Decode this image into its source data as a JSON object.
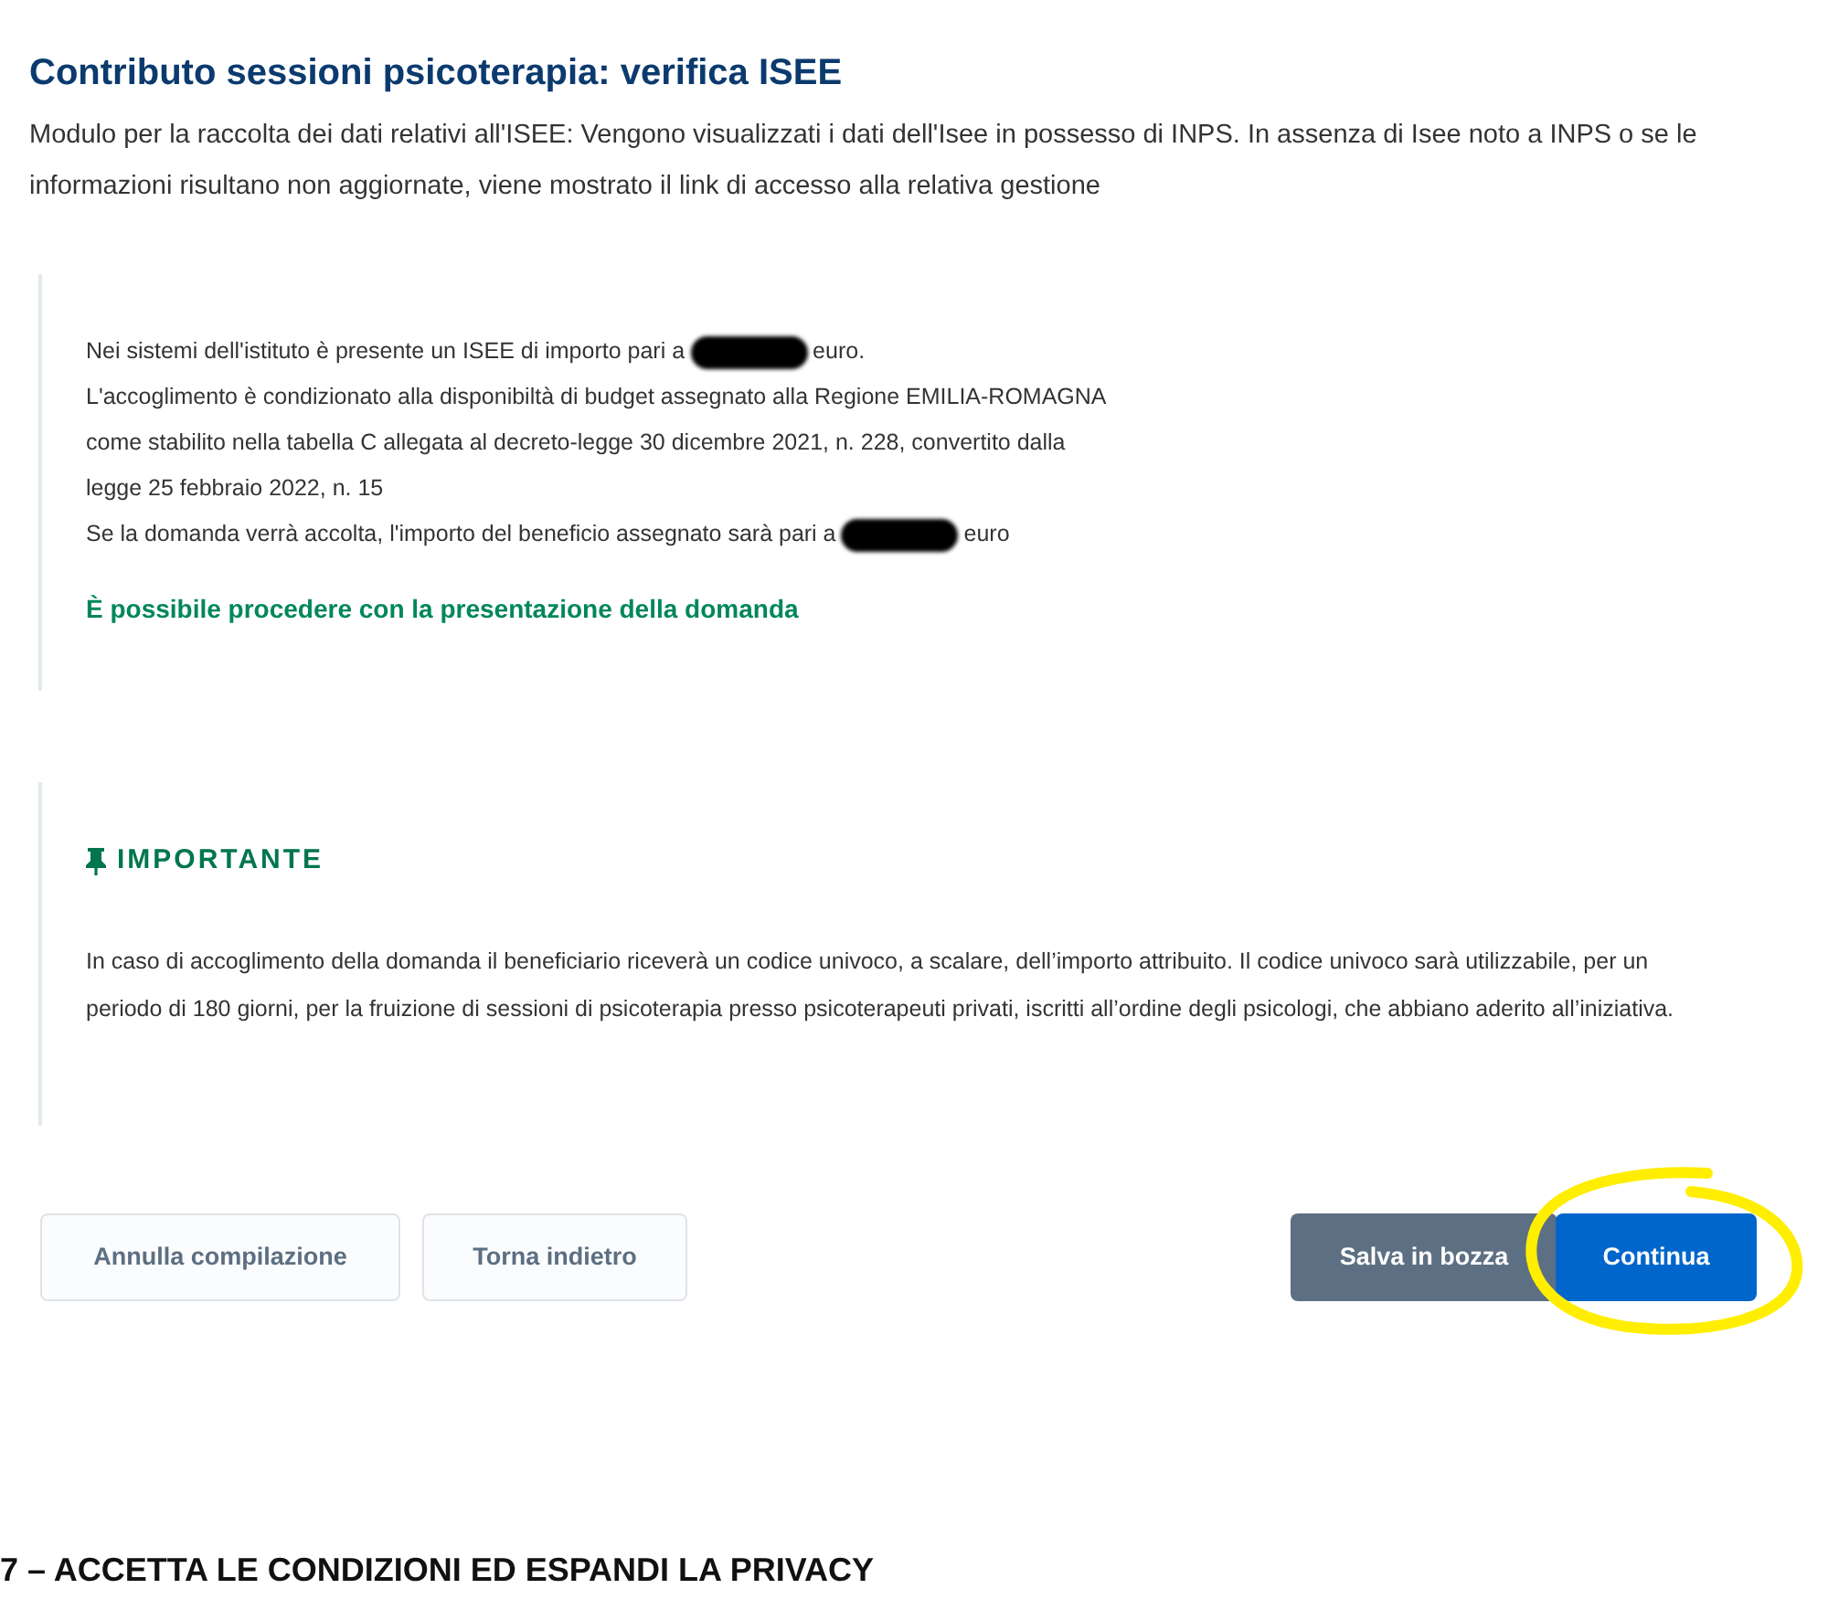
{
  "page": {
    "title": "Contributo sessioni psicoterapia: verifica ISEE",
    "description": "Modulo per la raccolta dei dati relativi all'ISEE: Vengono visualizzati i dati dell'Isee in possesso di INPS. In assenza di Isee noto a INPS o se le informazioni risultano non aggiornate, viene mostrato il link di accesso alla relativa gestione"
  },
  "isee_box": {
    "lines": [
      {
        "kind": "redacted",
        "before": "Nei sistemi dell'istituto è presente un ISEE di importo pari a",
        "after": "euro."
      },
      {
        "kind": "text",
        "text": "L'accoglimento è condizionato alla disponibiltà di budget assegnato alla Regione EMILIA-ROMAGNA"
      },
      {
        "kind": "text",
        "text": "come stabilito nella tabella C allegata al decreto-legge 30 dicembre 2021, n. 228, convertito dalla"
      },
      {
        "kind": "text",
        "text": "legge 25 febbraio 2022, n. 15"
      },
      {
        "kind": "redacted",
        "before": "Se la domanda verrà accolta, l'importo del beneficio assegnato sarà pari a",
        "after": "euro"
      }
    ],
    "outcome": "È possibile procedere con la presentazione della domanda"
  },
  "important_box": {
    "heading": "IMPORTANTE",
    "text": "In caso di accoglimento della domanda il beneficiario riceverà un codice univoco, a scalare, dell’importo attribuito. Il codice univoco sarà utilizzabile, per un periodo di 180 giorni, per la fruizione di sessioni di psicoterapia presso psicoterapeuti privati, iscritti all’ordine degli psicologi, che abbiano aderito all’iniziativa."
  },
  "buttons": [
    {
      "label": "Annulla compilazione",
      "kind": "outline"
    },
    {
      "label": "Torna indietro",
      "kind": "outline"
    },
    {
      "label": "Salva in bozza",
      "kind": "secondary"
    },
    {
      "label": "Continua",
      "kind": "primary",
      "highlighted": true
    }
  ],
  "caption": "7 – ACCETTA LE CONDIZIONI ED ESPANDI LA PRIVACY"
}
